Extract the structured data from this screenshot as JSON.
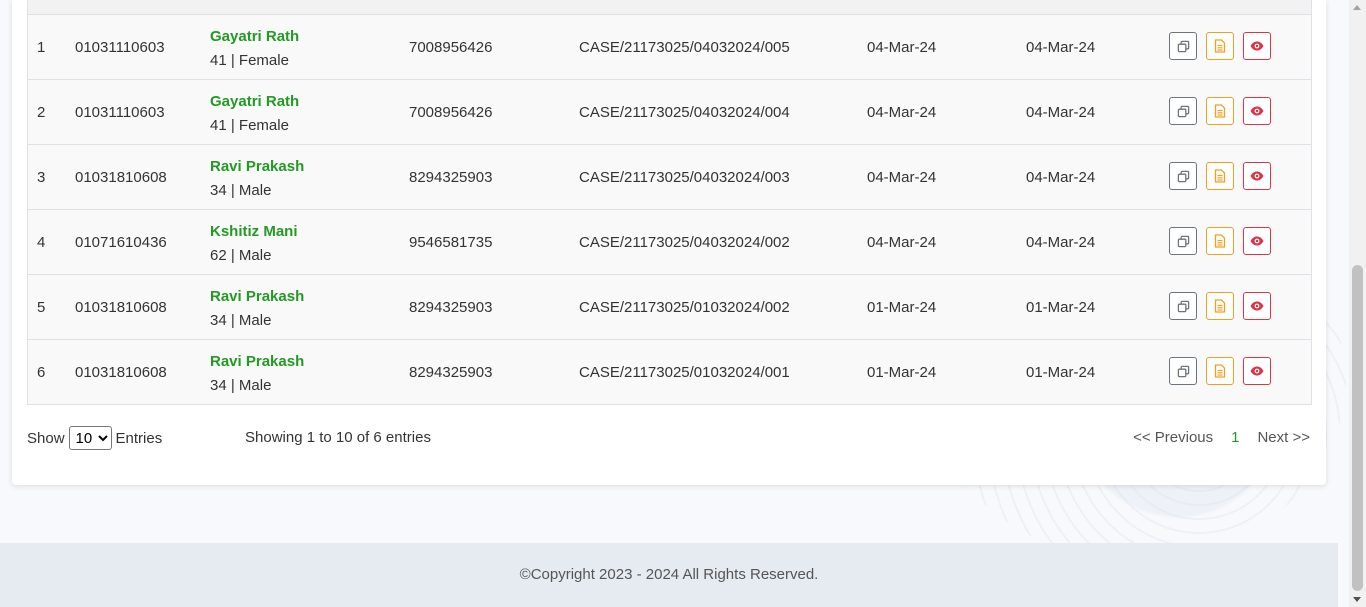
{
  "table": {
    "header_fragment": "~~~~~~~~",
    "rows": [
      {
        "num": "1",
        "patient_id": "01031110603",
        "name": "Gayatri Rath",
        "meta": "41 | Female",
        "phone": "7008956426",
        "case_no": "CASE/21173025/04032024/005",
        "date1": "04-Mar-24",
        "date2": "04-Mar-24"
      },
      {
        "num": "2",
        "patient_id": "01031110603",
        "name": "Gayatri Rath",
        "meta": "41 | Female",
        "phone": "7008956426",
        "case_no": "CASE/21173025/04032024/004",
        "date1": "04-Mar-24",
        "date2": "04-Mar-24"
      },
      {
        "num": "3",
        "patient_id": "01031810608",
        "name": "Ravi Prakash",
        "meta": "34 | Male",
        "phone": "8294325903",
        "case_no": "CASE/21173025/04032024/003",
        "date1": "04-Mar-24",
        "date2": "04-Mar-24"
      },
      {
        "num": "4",
        "patient_id": "01071610436",
        "name": "Kshitiz Mani",
        "meta": "62 | Male",
        "phone": "9546581735",
        "case_no": "CASE/21173025/04032024/002",
        "date1": "04-Mar-24",
        "date2": "04-Mar-24"
      },
      {
        "num": "5",
        "patient_id": "01031810608",
        "name": "Ravi Prakash",
        "meta": "34 | Male",
        "phone": "8294325903",
        "case_no": "CASE/21173025/01032024/002",
        "date1": "01-Mar-24",
        "date2": "01-Mar-24"
      },
      {
        "num": "6",
        "patient_id": "01031810608",
        "name": "Ravi Prakash",
        "meta": "34 | Male",
        "phone": "8294325903",
        "case_no": "CASE/21173025/01032024/001",
        "date1": "01-Mar-24",
        "date2": "01-Mar-24"
      }
    ],
    "action_icons": [
      "copy-icon",
      "document-icon",
      "eye-icon"
    ]
  },
  "controls": {
    "show_label": "Show",
    "entries_value": "10",
    "entries_label": "Entries",
    "info": "Showing 1 to 10 of 6 entries",
    "prev": "<< Previous",
    "current_page": "1",
    "next": "Next >>"
  },
  "footer": {
    "copyright": "©Copyright 2023 - 2024 All Rights Reserved."
  },
  "colors": {
    "name_green": "#229a23",
    "copy_btn": "#6c757d",
    "doc_btn": "#f0a020",
    "view_btn": "#dc3545"
  }
}
